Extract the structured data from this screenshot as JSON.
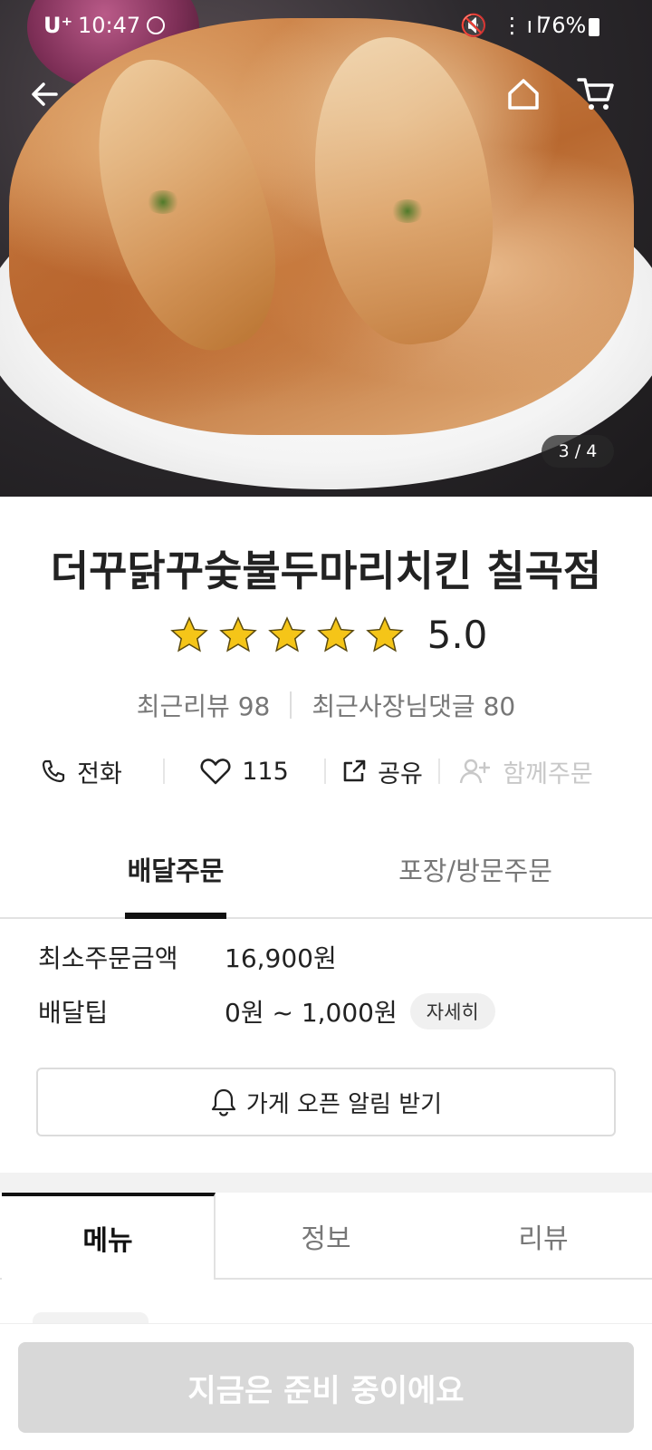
{
  "status_bar": {
    "carrier": "U⁺",
    "time": "10:47",
    "signal_icons": "🔇 ⋮ıl",
    "battery": "76%"
  },
  "hero": {
    "image_counter": "3 / 4"
  },
  "store": {
    "name": "더꾸닭꾸숯불두마리치킨 칠곡점",
    "rating": "5.0",
    "star_count": 5,
    "star_color": "#f5c518",
    "recent_reviews": "최근리뷰 98",
    "owner_replies": "최근사장님댓글 80"
  },
  "actions": {
    "call": "전화",
    "likes": "115",
    "share": "공유",
    "group_order": "함께주문"
  },
  "order_tabs": {
    "delivery": "배달주문",
    "pickup": "포장/방문주문"
  },
  "order_info": {
    "min_order_label": "최소주문금액",
    "min_order_value": "16,900원",
    "delivery_tip_label": "배달팁",
    "delivery_tip_value": "0원 ~ 1,000원",
    "detail_button": "자세히",
    "notify_button": "가게 오픈 알림 받기"
  },
  "menu_tabs": {
    "menu": "메뉴",
    "info": "정보",
    "reviews": "리뷰"
  },
  "bottom": {
    "ready_button": "지금은 준비 중이에요",
    "ready_button_color": "#d8d8d8"
  }
}
